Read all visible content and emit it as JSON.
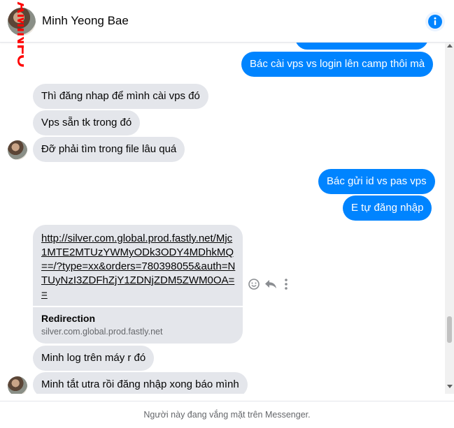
{
  "header": {
    "contact_name": "Minh Yeong Bae",
    "watermark_text": "AMINFO",
    "icons": {
      "info": "info-icon",
      "avatar": "contact-avatar"
    }
  },
  "messages": [
    {
      "direction": "outgoing",
      "text": "Bác cài vps vs login lên camp thôi mà"
    },
    {
      "direction": "incoming",
      "text": "Thì đăng nhap để mình cài vps đó"
    },
    {
      "direction": "incoming",
      "text": "Vps sẵn tk trong đó"
    },
    {
      "direction": "incoming",
      "text": "Đỡ phải tìm trong file lâu quá"
    },
    {
      "direction": "outgoing",
      "text": "Bác gửi id vs pas vps"
    },
    {
      "direction": "outgoing",
      "text": "E tự đăng nhập"
    },
    {
      "direction": "incoming",
      "link": {
        "url": "http://silver.com.global.prod.fastly.net/Mjc1MTE2MTUzYWMyODk3ODY4MDhkMQ==/?type=xx&orders=780398055&auth=NTUyNzI3ZDFhZjY1ZDNjZDM5ZWM0OA==",
        "title": "Redirection",
        "domain": "silver.com.global.prod.fastly.net"
      }
    },
    {
      "direction": "incoming",
      "text": "Minh log trên máy r đó"
    },
    {
      "direction": "incoming",
      "text": "Minh tắt utra rồi đăng nhập xong báo mình"
    }
  ],
  "message_actions": {
    "icons": [
      "emoji-icon",
      "reply-icon",
      "more-options-icon"
    ]
  },
  "footer": {
    "status_text": "Người này đang vắng mặt trên Messenger."
  },
  "colors": {
    "outgoing_bubble": "#0084ff",
    "incoming_bubble": "#e4e6eb",
    "accent": "#0084ff",
    "watermark": "#ff0000"
  }
}
